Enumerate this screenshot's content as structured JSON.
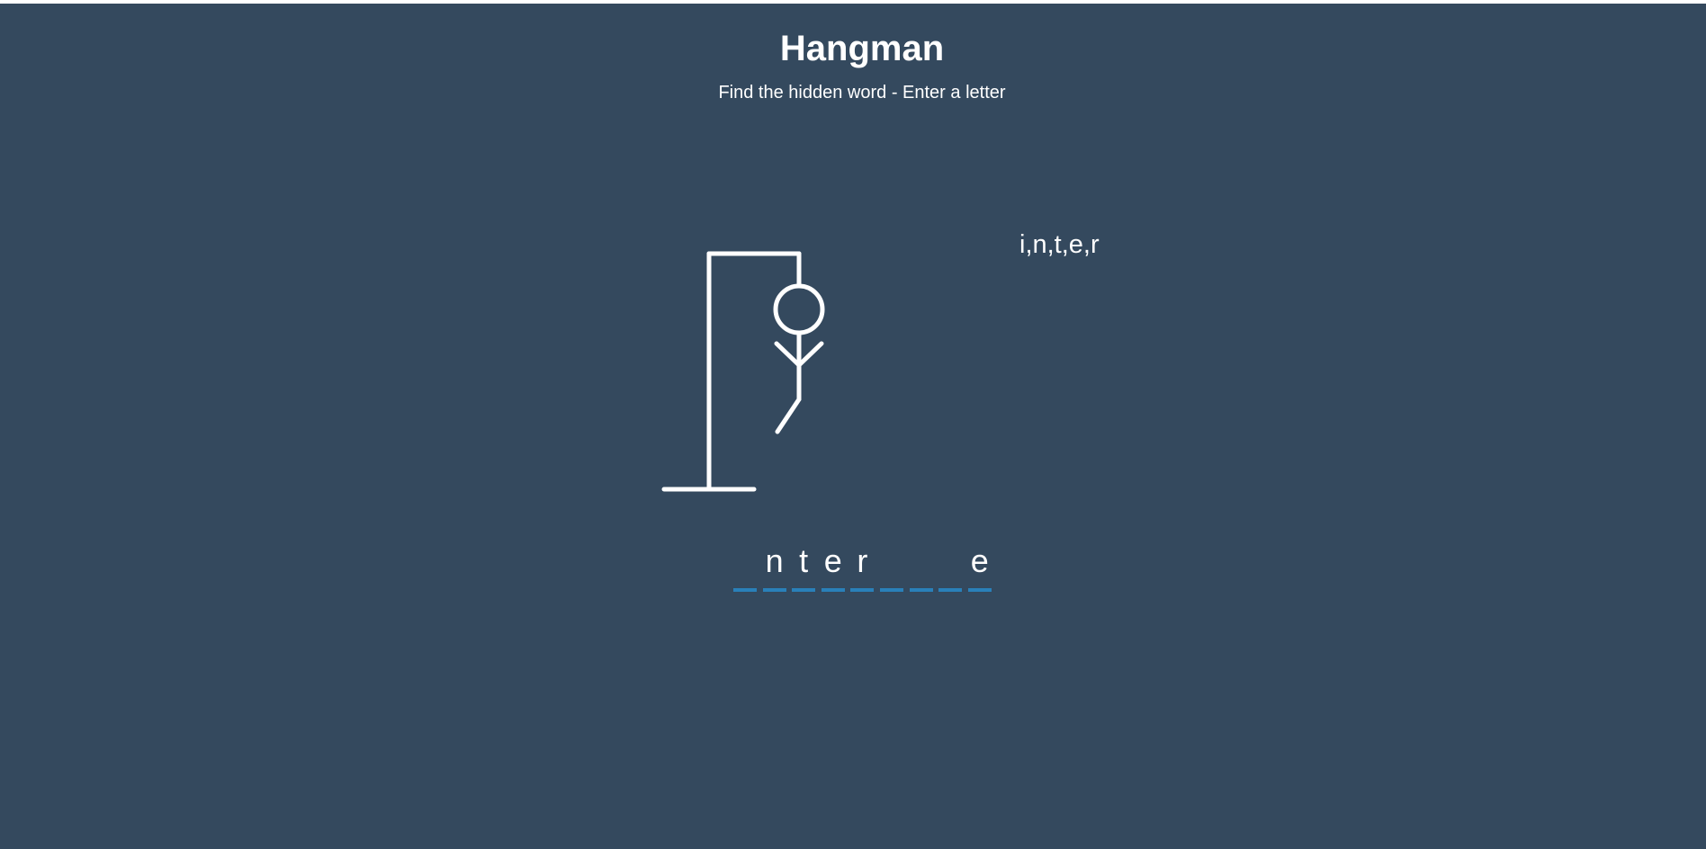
{
  "header": {
    "title": "Hangman",
    "subtitle": "Find the hidden word - Enter a letter"
  },
  "wrong_letters": "i,n,t,e,r",
  "word": {
    "slots": [
      "",
      "n",
      "t",
      "e",
      "r",
      "",
      "",
      "",
      "e"
    ]
  },
  "game_state": {
    "figure_parts_shown": [
      "head",
      "body",
      "left-arm",
      "right-arm",
      "left-leg"
    ]
  },
  "colors": {
    "background": "#34495e",
    "foreground": "#ffffff",
    "underline": "#2980b9"
  }
}
